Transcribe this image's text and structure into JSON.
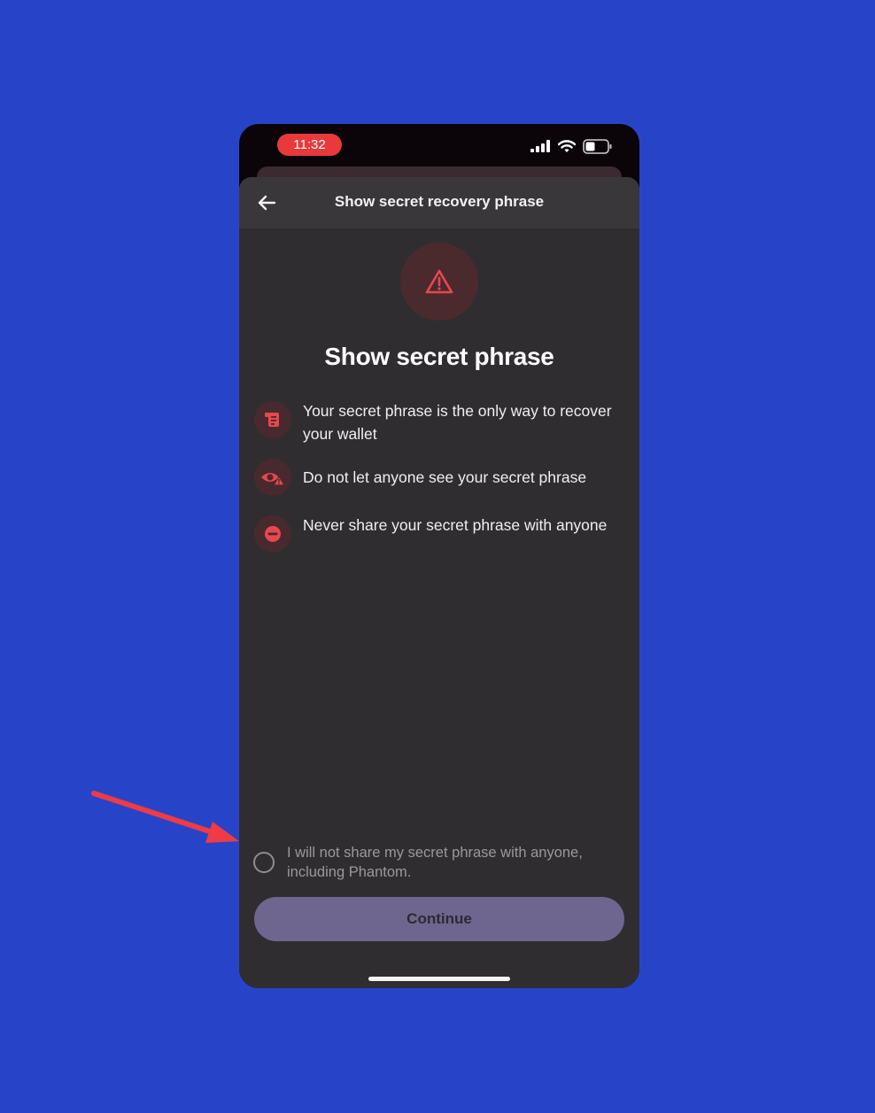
{
  "status_bar": {
    "time": "11:32",
    "icons": [
      "signal-icon",
      "wifi-icon",
      "battery-icon"
    ]
  },
  "nav": {
    "back_icon": "arrow-left-icon",
    "title": "Show secret recovery phrase"
  },
  "main": {
    "warning_icon": "warning-triangle-icon",
    "heading": "Show secret phrase",
    "items": [
      {
        "icon": "scroll-document-icon",
        "text": "Your secret phrase is the only way to recover your wallet"
      },
      {
        "icon": "eye-warning-icon",
        "text": "Do not let anyone see your secret phrase"
      },
      {
        "icon": "no-entry-icon",
        "text": "Never share your secret phrase with anyone"
      }
    ]
  },
  "acknowledgement": {
    "label": "I will not share my secret phrase with anyone, including Phantom.",
    "checked": false
  },
  "continue_label": "Continue",
  "colors": {
    "background": "#2744c9",
    "sheet": "#302d31",
    "accent_red": "#e8474f",
    "button": "#6f668f",
    "annotation_arrow": "#ee3b45"
  }
}
